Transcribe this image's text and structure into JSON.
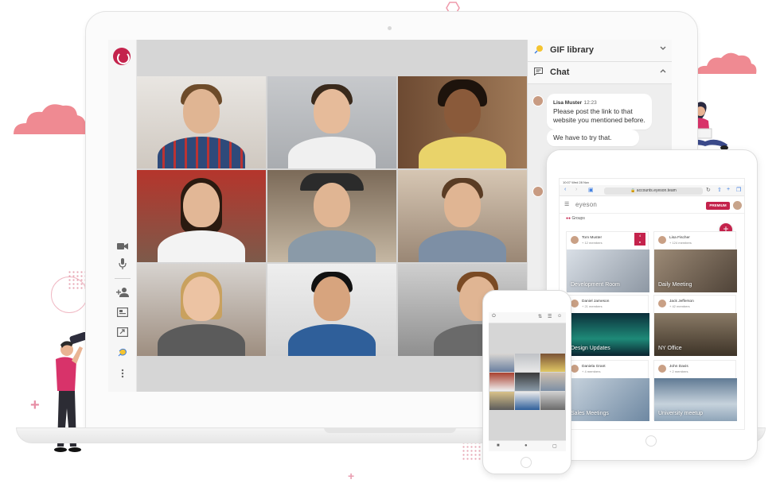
{
  "colors": {
    "brand": "#c4234c",
    "cloud": "#ef8a92",
    "screen_bg": "#d6d6d6"
  },
  "laptop": {
    "sidebar": {
      "icons": [
        "logo-icon",
        "camera-icon",
        "microphone-icon",
        "add-user-icon",
        "screen-share-icon",
        "presentation-icon",
        "gif-icon",
        "more-icon"
      ]
    },
    "panels": {
      "gif_library": {
        "label": "GIF library",
        "icon": "gif-icon",
        "state": "collapsed"
      },
      "chat": {
        "label": "Chat",
        "icon": "chat-icon",
        "state": "expanded"
      }
    },
    "chat_messages": [
      {
        "author": "Lisa Muster",
        "time": "12:23",
        "text": "Please post the link to that website you mentioned before."
      },
      {
        "author": "",
        "time": "",
        "text": "We have to try that."
      }
    ]
  },
  "tablet": {
    "status_time": "10:07",
    "status_date": "Wed 28 Nov",
    "url": "accounts.eyeson.team",
    "brand": "eyeson",
    "premium_label": "PREMIUM",
    "groups_label": "Groups",
    "groups": [
      {
        "owner": "Tom Muster",
        "members": "+ 12 members",
        "title": "Development Room"
      },
      {
        "owner": "Lisa Fischer",
        "members": "+ 124 members",
        "title": "Daily Meeting"
      },
      {
        "owner": "Daniel Jameson",
        "members": "+ 21 members",
        "title": "Design Updates"
      },
      {
        "owner": "Jack Jefferson",
        "members": "+ 42 members",
        "title": "NY Office"
      },
      {
        "owner": "Daniela Grant",
        "members": "+ 4 members",
        "title": "Sales Meetings"
      },
      {
        "owner": "John Davis",
        "members": "+ 2 members",
        "title": "University meetup"
      }
    ]
  }
}
